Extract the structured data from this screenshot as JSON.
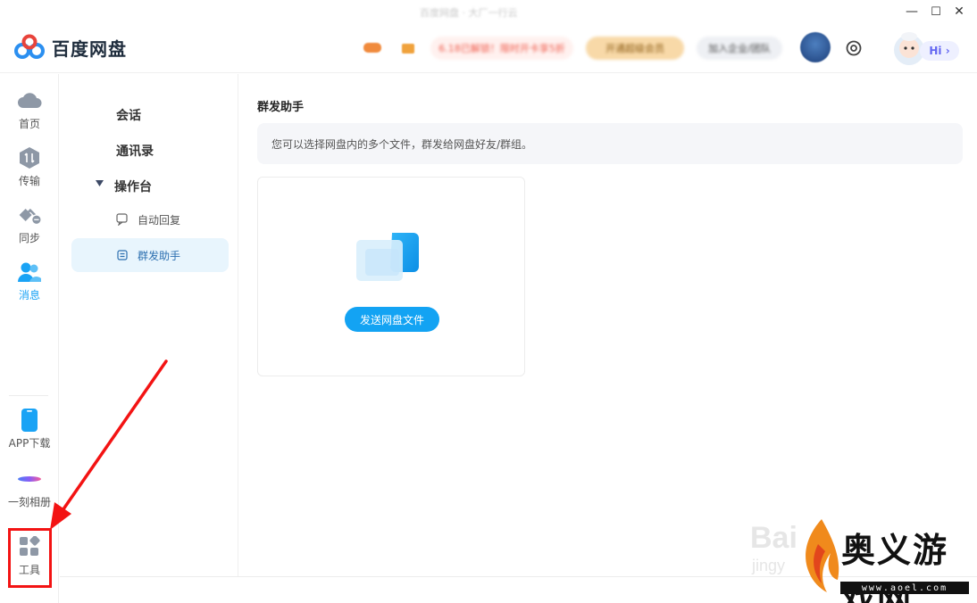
{
  "window": {
    "title": "百度网盘 · 大厂一行云",
    "controls": {
      "minimize": "—",
      "maximize": "☐",
      "close": "✕"
    }
  },
  "header": {
    "logo_text": "百度网盘",
    "chip_red": "6.18已解锁！限时开卡享5折",
    "chip_vip": "开通超级会员",
    "chip_gray": "加入企业/团队",
    "hi_label": "Hi ›"
  },
  "rail": {
    "items": [
      {
        "label": "首页",
        "icon": "cloud-icon"
      },
      {
        "label": "传输",
        "icon": "transfer-icon"
      },
      {
        "label": "同步",
        "icon": "sync-icon"
      },
      {
        "label": "消息",
        "icon": "people-icon",
        "active": true
      },
      {
        "label": "APP下载",
        "icon": "phone-icon"
      },
      {
        "label": "一刻相册",
        "icon": "album-icon"
      },
      {
        "label": "工具",
        "icon": "tools-icon"
      }
    ]
  },
  "subnav": {
    "items": [
      {
        "label": "会话"
      },
      {
        "label": "通讯录"
      },
      {
        "label": "操作台"
      }
    ],
    "sub_items": [
      {
        "label": "自动回复",
        "icon": "auto-reply-icon"
      },
      {
        "label": "群发助手",
        "icon": "broadcast-icon",
        "active": true
      }
    ]
  },
  "main": {
    "title": "群发助手",
    "banner": "您可以选择网盘内的多个文件，群发给网盘好友/群组。",
    "send_button": "发送网盘文件"
  },
  "watermark": {
    "baidu": "Bai",
    "jingyan": "jingy",
    "brand": "奥义游戏网",
    "url": "www.aoel.com"
  },
  "colors": {
    "accent": "#13a3f3",
    "annotation": "#f31313",
    "active_bg": "#e8f5fd"
  }
}
